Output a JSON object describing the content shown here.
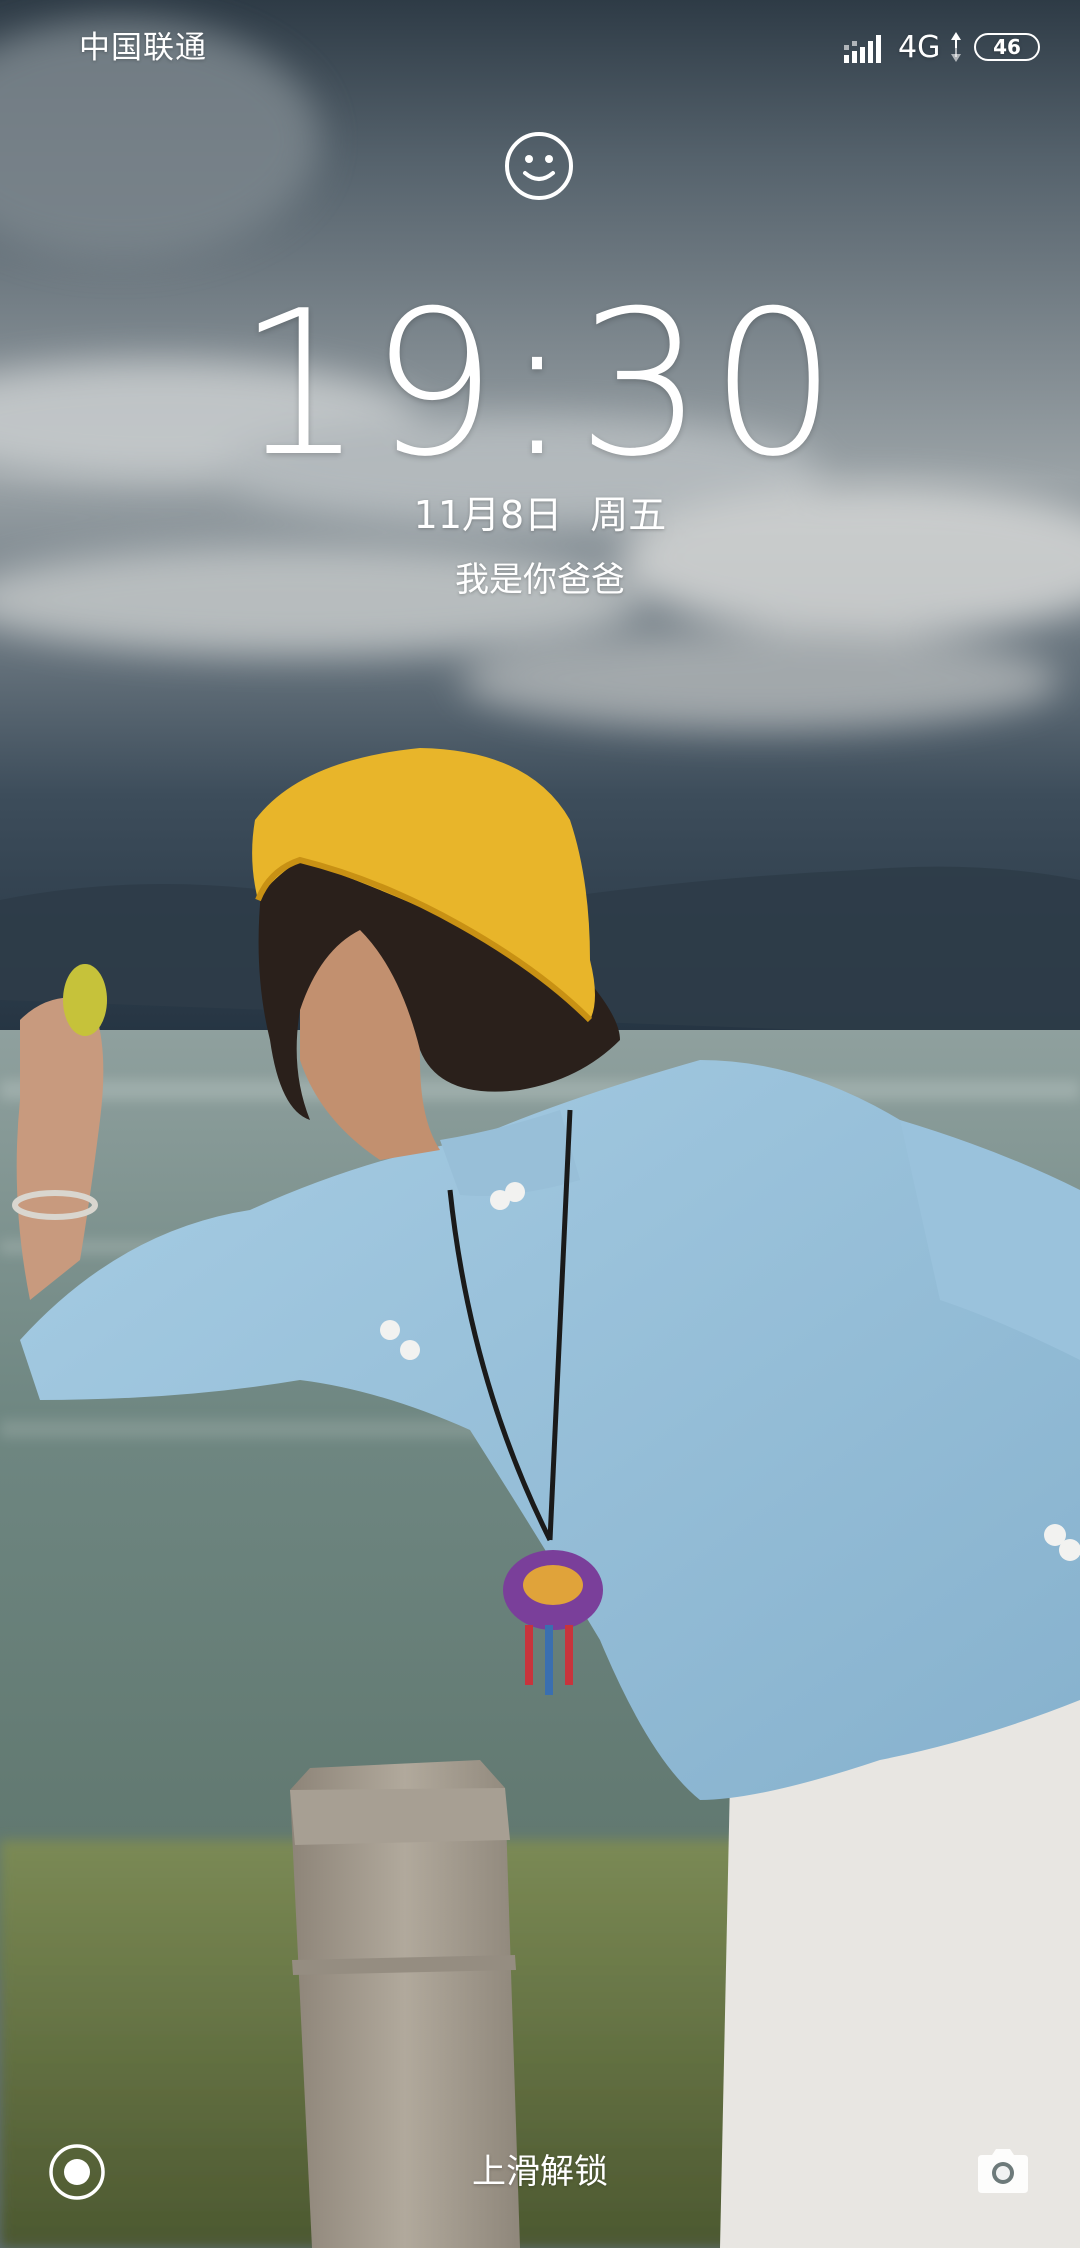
{
  "status_bar": {
    "carrier": "中国联通",
    "network_type": "4G",
    "battery_level": "46",
    "signal_icon": "signal-bars-icon",
    "data_icon": "data-arrows-icon"
  },
  "lock_screen": {
    "assistant_icon": "smiley-face-icon",
    "time": "19:30",
    "date": "11月8日",
    "weekday": "周五",
    "owner_info": "我是你爸爸",
    "unlock_hint": "上滑解锁",
    "left_shortcut_icon": "voice-assistant-icon",
    "right_shortcut_icon": "camera-icon"
  },
  "colors": {
    "text": "#ffffff",
    "hat": "#e8b52a",
    "shirt": "#9cc3dc",
    "sea": "#6f8a86",
    "sky": "#4a5a66"
  }
}
